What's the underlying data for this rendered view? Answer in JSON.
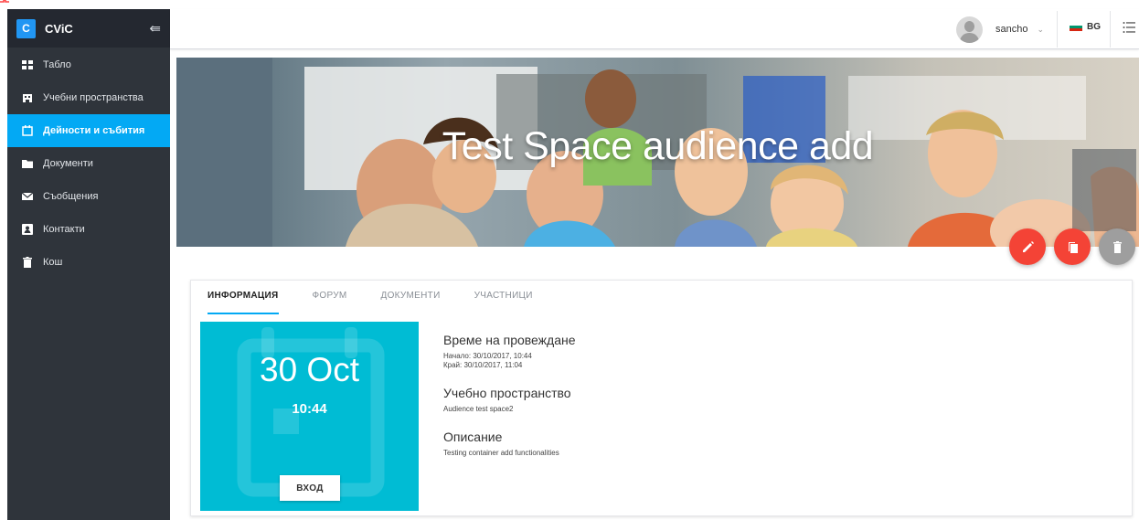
{
  "app": {
    "brand_letter": "C",
    "brand_name": "CViC"
  },
  "sidebar": {
    "items": [
      {
        "label": "Табло",
        "icon": "dashboard-icon",
        "active": false
      },
      {
        "label": "Учебни пространства",
        "icon": "building-icon",
        "active": false
      },
      {
        "label": "Дейности и събития",
        "icon": "calendar-icon",
        "active": true
      },
      {
        "label": "Документи",
        "icon": "folder-icon",
        "active": false
      },
      {
        "label": "Съобщения",
        "icon": "envelope-icon",
        "active": false
      },
      {
        "label": "Контакти",
        "icon": "contact-card-icon",
        "active": false
      },
      {
        "label": "Кош",
        "icon": "trash-icon",
        "active": false
      }
    ]
  },
  "topbar": {
    "username": "sancho",
    "language": "BG"
  },
  "banner": {
    "title": "Test Space audience add"
  },
  "tabs": [
    {
      "label": "ИНФОРМАЦИЯ",
      "active": true
    },
    {
      "label": "ФОРУМ",
      "active": false
    },
    {
      "label": "ДОКУМЕНТИ",
      "active": false
    },
    {
      "label": "УЧАСТНИЦИ",
      "active": false
    }
  ],
  "event": {
    "date": "30 Oct",
    "time": "10:44",
    "enter_label": "ВХОД",
    "time_heading": "Време на провеждане",
    "start": "Начало: 30/10/2017, 10:44",
    "end": "Край: 30/10/2017, 11:04",
    "space_heading": "Учебно пространство",
    "space_name": "Audience test space2",
    "description_heading": "Описание",
    "description": "Testing container add functionalities"
  },
  "colors": {
    "sidebar": "#2f343b",
    "active": "#03a9f4",
    "tile": "#00bcd4",
    "red": "#f44336",
    "grey": "#9e9e9e"
  }
}
